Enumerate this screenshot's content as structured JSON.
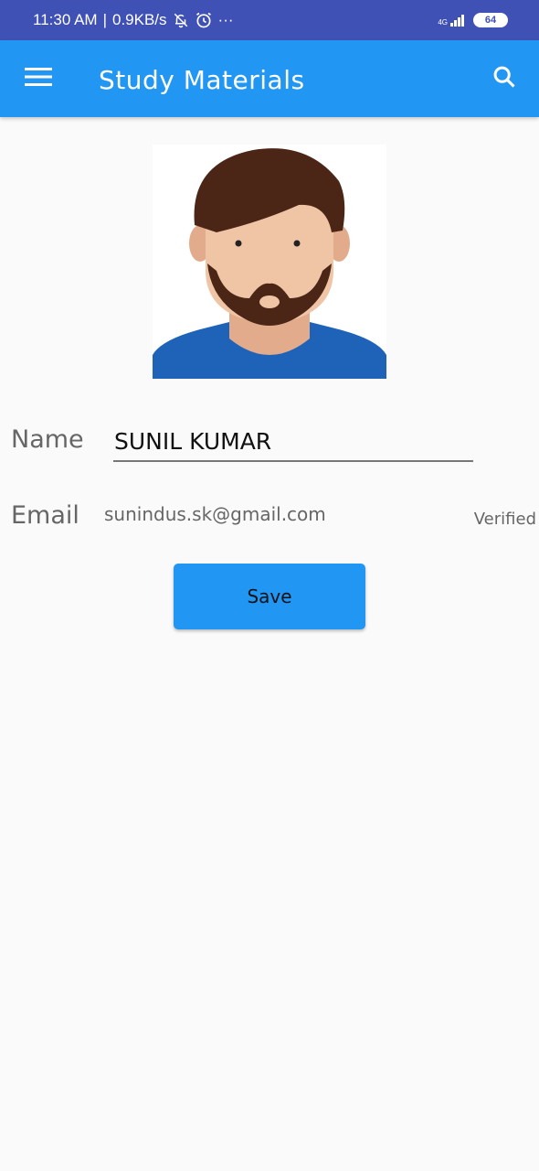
{
  "status_bar": {
    "time": "11:30 AM",
    "separator": "|",
    "speed": "0.9KB/s",
    "more": "···",
    "network": "4G",
    "battery": "64",
    "icons": [
      "bell-off-icon",
      "alarm-icon",
      "signal-icon",
      "battery-icon"
    ]
  },
  "app_bar": {
    "title": "Study Materials",
    "color": "#2196f3",
    "icons": [
      "menu-icon",
      "search-icon"
    ]
  },
  "profile": {
    "avatar_icon": "avatar-icon",
    "name_label": "Name",
    "name_value": "SUNIL KUMAR",
    "email_label": "Email",
    "email_value": "sunindus.sk@gmail.com",
    "verified_text": "Verified",
    "save_label": "Save"
  },
  "colors": {
    "status_bar": "#3f51b5",
    "accent": "#2196f3",
    "background": "#fafafa"
  }
}
